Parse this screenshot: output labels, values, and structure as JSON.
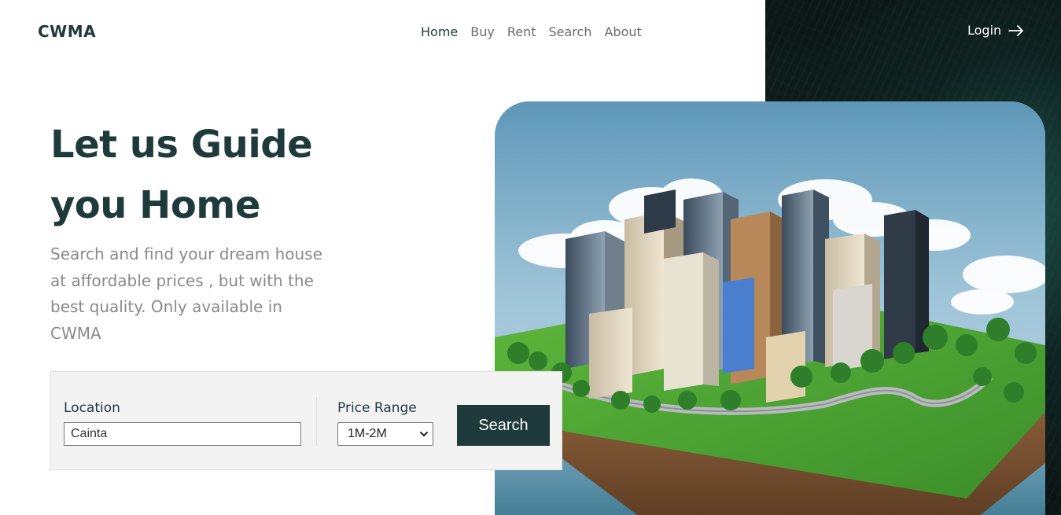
{
  "brand": {
    "logo": "CWMA"
  },
  "nav": {
    "items": [
      {
        "label": "Home",
        "active": true
      },
      {
        "label": "Buy",
        "active": false
      },
      {
        "label": "Rent",
        "active": false
      },
      {
        "label": "Search",
        "active": false
      },
      {
        "label": "About",
        "active": false
      }
    ],
    "login_label": "Login",
    "login_icon": "arrow-right-icon"
  },
  "hero": {
    "title_line1": "Let us Guide",
    "title_line2": "you Home",
    "subtitle": "Search and find your dream house at affordable prices , but with the best quality. Only available in CWMA",
    "image": "isometric-city-island"
  },
  "search": {
    "location_label": "Location",
    "location_value": "Cainta",
    "price_label": "Price Range",
    "price_selected": "1M-2M",
    "button_label": "Search"
  },
  "colors": {
    "primary": "#1e3a3b",
    "muted_text": "#8a8a8a",
    "panel_dark": "#0f2321",
    "search_box_bg": "#f3f3f3"
  }
}
